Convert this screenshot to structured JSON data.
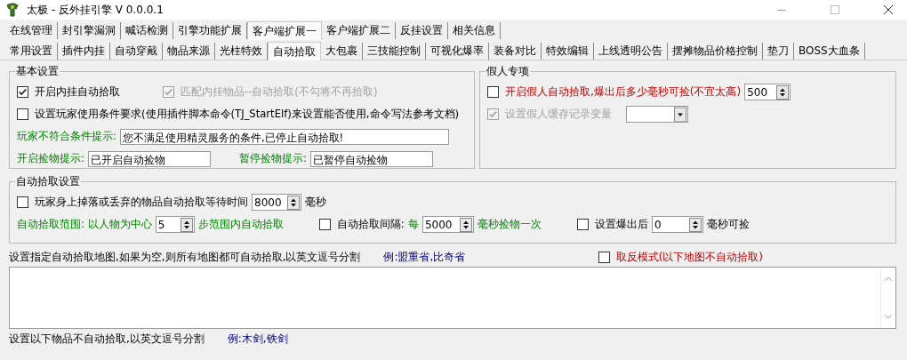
{
  "window": {
    "title": "太极 - 反外挂引擎 V 0.0.0.1"
  },
  "tabs": [
    {
      "label": "在线管理",
      "selected": false
    },
    {
      "label": "封引擎漏洞",
      "selected": false
    },
    {
      "label": "喊话检测",
      "selected": false
    },
    {
      "label": "引擎功能扩展",
      "selected": false
    },
    {
      "label": "客户端扩展一",
      "selected": true
    },
    {
      "label": "客户端扩展二",
      "selected": false
    },
    {
      "label": "反挂设置",
      "selected": false
    },
    {
      "label": "相关信息",
      "selected": false
    }
  ],
  "subtabs": [
    {
      "label": "常用设置",
      "selected": false
    },
    {
      "label": "插件内挂",
      "selected": false
    },
    {
      "label": "自动穿戴",
      "selected": false
    },
    {
      "label": "物品来源",
      "selected": false
    },
    {
      "label": "光柱特效",
      "selected": false
    },
    {
      "label": "自动拾取",
      "selected": true
    },
    {
      "label": "大包裹",
      "selected": false
    },
    {
      "label": "三技能控制",
      "selected": false
    },
    {
      "label": "可视化爆率",
      "selected": false
    },
    {
      "label": "装备对比",
      "selected": false
    },
    {
      "label": "特效编辑",
      "selected": false
    },
    {
      "label": "上线透明公告",
      "selected": false
    },
    {
      "label": "摆摊物品价格控制",
      "selected": false
    },
    {
      "label": "垫刀",
      "selected": false
    },
    {
      "label": "BOSS大血条",
      "selected": false
    }
  ],
  "basic": {
    "title": "基本设置",
    "checkboxes": [
      {
        "label": "开启内挂自动拾取",
        "checked": true,
        "disabled": false
      },
      {
        "label": "匹配内挂物品--自动拾取(不勾将不再拾取)",
        "checked": true,
        "disabled": true
      },
      {
        "label": "设置玩家使用条件要求(使用插件脚本命令(TJ_StartElf)来设置能否使用,命令写法参考文档)",
        "checked": false,
        "disabled": false
      }
    ],
    "fields": [
      {
        "label": "玩家不符合条件提示:",
        "value": "您不满足使用精灵服务的条件,已停止自动拾取!"
      },
      {
        "label": "开启捡物提示:",
        "value": "已开启自动捡物"
      },
      {
        "label": "暂停捡物提示:",
        "value": "已暂停自动捡物"
      }
    ]
  },
  "fake_player": {
    "title": "假人专项",
    "options": [
      {
        "kind": "spin",
        "label": "开启假人自动拾取,爆出后多少毫秒可捡(不宜太高)",
        "checked": false,
        "disabled": false,
        "value": "500"
      },
      {
        "kind": "combo",
        "label": "设置假人缓存记录变量",
        "checked": true,
        "disabled": true
      }
    ]
  },
  "pickup": {
    "title": "自动拾取设置",
    "wait": {
      "label": "玩家身上掉落或丢弃的物品自动拾取等待时间",
      "checked": false,
      "value": "8000",
      "unit": "毫秒"
    },
    "range": {
      "label": "自动拾取范围: 以人物为中心",
      "value": "5",
      "suffix": "步范围内自动拾取"
    },
    "interval": {
      "label": "自动拾取间隔:",
      "checked": false,
      "prefix": "每",
      "value": "5000",
      "suffix": "毫秒捡物一次"
    },
    "delay": {
      "label": "设置爆出后",
      "checked": false,
      "value": "0",
      "suffix": "毫秒可捡"
    }
  },
  "map_filter": {
    "label": "设置指定自动拾取地图,如果为空,则所有地图都可自动拾取,以英文逗号分割",
    "example": "例:盟重省,比奇省",
    "invert": {
      "label": "取反模式(以下地图不自动拾取)",
      "checked": false
    }
  },
  "item_filter": {
    "label": "设置以下物品不自动拾取,以英文逗号分割",
    "example": "例:木剑,铁剑"
  }
}
